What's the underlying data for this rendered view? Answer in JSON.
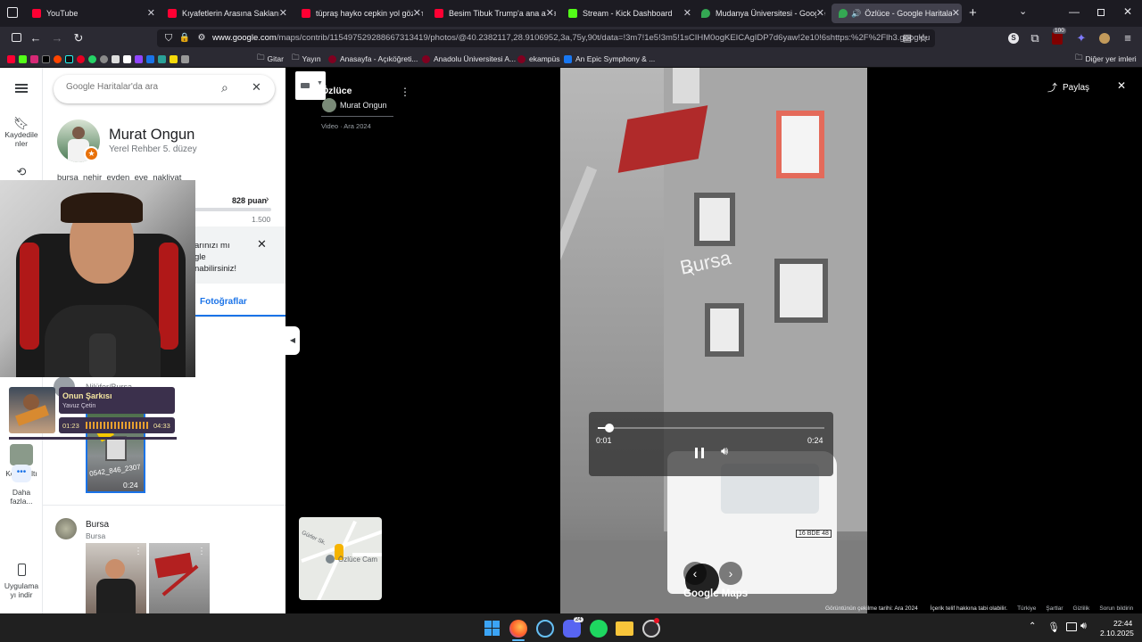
{
  "tabs": [
    {
      "label": "YouTube",
      "color": "#ff0033"
    },
    {
      "label": "Kıyafetlerin Arasına Saklanı",
      "color": "#ff0033"
    },
    {
      "label": "tüpraş hayko cepkin yol gözüm",
      "color": "#ff0033"
    },
    {
      "label": "Besim Tibuk Trump'a ana avrat",
      "color": "#ff0033"
    },
    {
      "label": "Stream - Kick Dashboard",
      "color": "#53fc18"
    },
    {
      "label": "Mudanya Üniversitesi - Google",
      "color": "#34a853"
    },
    {
      "label": "Özlüce - Google Haritalar",
      "color": "#34a853"
    }
  ],
  "url": {
    "host": "www.google.com",
    "rest": "/maps/contrib/115497529288667313419/photos/@40.2382117,28.9106952,3a,75y,90t/data=!3m7!1e5!3m5!1sCIHM0ogKEICAgIDP7d6yaw!2e10!6shttps:%2F%2Flh3.googleu"
  },
  "ext_badge": "100",
  "bookmarks": [
    "Gitar",
    "Yayın",
    "Anasayfa - Açıköğreti...",
    "Anadolu Üniversitesi A...",
    "ekampüs",
    "An Epic Symphony & ..."
  ],
  "other_bookmarks": "Diğer yer imleri",
  "rail": {
    "saved": "Kaydedile\nnler",
    "recents_label": "Konyaaltı",
    "more": "Daha\nfazla...",
    "app": "Uygulama\nyı indir"
  },
  "search": {
    "placeholder": "Google Haritalar'da ara"
  },
  "profile": {
    "name": "Murat Ongun",
    "level": "Yerel Rehber 5. düzey",
    "bio": "bursa_nehir_evden_eve_nakliyat",
    "points": "828 puan",
    "points_max": "1.500"
  },
  "notice": {
    "line1": "arınızı mı",
    "line2": "gle",
    "line3": "nabilirsiniz!"
  },
  "panel_tab": "Fotoğraflar",
  "place1": {
    "name": "Nilüfer/Bursa",
    "duration": "0:24",
    "overlay": "0542_846_2307"
  },
  "place2": {
    "name": "Bursa",
    "sub": "Bursa"
  },
  "music": {
    "title": "Onun Şarkısı",
    "artist": "Yavuz Çetin",
    "elapsed": "01:23",
    "total": "04:33"
  },
  "viewer": {
    "place": "Özlüce",
    "contributor": "Murat Ongun",
    "meta": "Video · Ara 2024",
    "minimap_label": "Özlüce Cam",
    "minimap_road": "Gürler Sk.",
    "share": "Paylaş",
    "watermark": "Bursa",
    "logo": "Google Maps",
    "time_current": "0:01",
    "time_total": "0:24",
    "progress": 0.05,
    "truck_plate": "16 BDE 48"
  },
  "footer": {
    "capture": "Görüntünün çekilme tarihi: Ara 2024",
    "copyright": "İçerik telif hakkına tabi olabilir.",
    "country": "Türkiye",
    "terms": "Şartlar",
    "privacy": "Gizlilik",
    "feedback": "Sorun bildirin"
  },
  "taskbar": {
    "time": "22:44",
    "date": "2.10.2025",
    "discord_badge": "24"
  }
}
